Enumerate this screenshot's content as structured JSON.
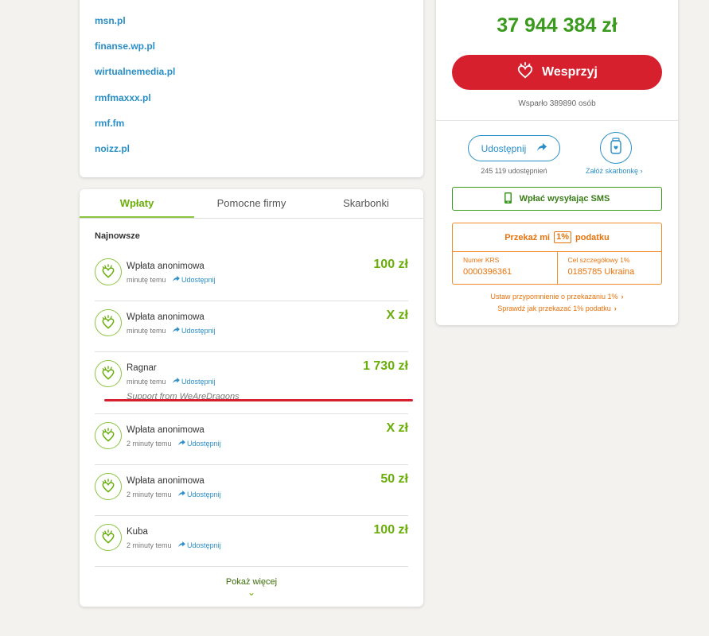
{
  "links": [
    "msn.pl",
    "finanse.wp.pl",
    "wirtualnemedia.pl",
    "rmfmaxxx.pl",
    "rmf.fm",
    "noizz.pl"
  ],
  "tabs": [
    "Wpłaty",
    "Pomocne firmy",
    "Skarbonki"
  ],
  "section_label": "Najnowsze",
  "donations": [
    {
      "name": "Wpłata anonimowa",
      "time": "minutę temu",
      "share": "Udostępnij",
      "amount": "100 zł"
    },
    {
      "name": "Wpłata anonimowa",
      "time": "minutę temu",
      "share": "Udostępnij",
      "amount": "X zł"
    },
    {
      "name": "Ragnar",
      "time": "minutę temu",
      "share": "Udostępnij",
      "amount": "1 730 zł",
      "message": "Support from WeAreDragons"
    },
    {
      "name": "Wpłata anonimowa",
      "time": "2 minuty temu",
      "share": "Udostępnij",
      "amount": "X zł"
    },
    {
      "name": "Wpłata anonimowa",
      "time": "2 minuty temu",
      "share": "Udostępnij",
      "amount": "50 zł"
    },
    {
      "name": "Kuba",
      "time": "2 minuty temu",
      "share": "Udostępnij",
      "amount": "100 zł"
    }
  ],
  "show_more": "Pokaż więcej",
  "sidebar": {
    "total": "37 944 384 zł",
    "support_button": "Wesprzyj",
    "supported_by": "Wsparło 389890 osób",
    "share_button": "Udostępnij",
    "share_count": "245 119 udostępnień",
    "piggy_label": "Załóż skarbonkę",
    "sms_button": "Wpłać wysyłając SMS",
    "tax": {
      "head_before": "Przekaż mi",
      "head_badge": "1%",
      "head_after": "podatku",
      "krs_label": "Numer KRS",
      "krs_value": "0000396361",
      "goal_label": "Cel szczegółowy 1%",
      "goal_value": "0185785 Ukraina"
    },
    "reminder_link": "Ustaw przypomnienie o przekazaniu 1%",
    "howto_link": "Sprawdź jak przekazać 1% podatku"
  },
  "colors": {
    "green": "#6aae0a",
    "red": "#d6202d",
    "blue": "#2a8fc7",
    "orange": "#e8720c"
  }
}
